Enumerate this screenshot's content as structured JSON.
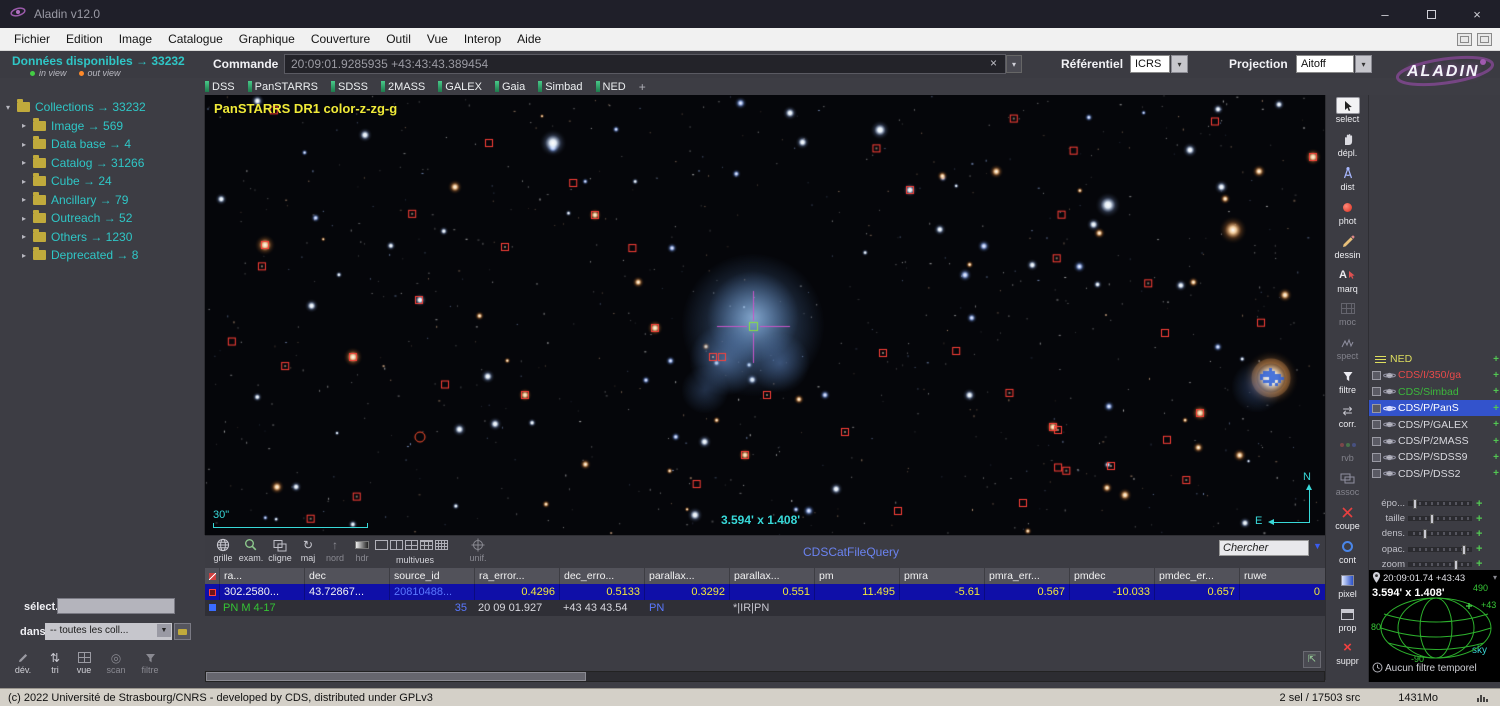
{
  "window": {
    "title": "Aladin v12.0",
    "status_left": "(c) 2022 Université de Strasbourg/CNRS - developed by CDS, distributed under GPLv3",
    "status_sel": "2 sel / 17503 src",
    "status_mem": "1431Mo"
  },
  "icons": {
    "minimize": "–",
    "close": "×",
    "dropdown": "▾",
    "down_arrow": "▼",
    "up_arrow": "▲",
    "plus": "+",
    "clear": "×",
    "refresh": "↻",
    "swap": "⇄",
    "sort": "⇅",
    "scan": "◎",
    "north": "↑",
    "export": "⇱"
  },
  "menu": {
    "items": [
      "Fichier",
      "Edition",
      "Image",
      "Catalogue",
      "Graphique",
      "Couverture",
      "Outil",
      "Vue",
      "Interop",
      "Aide"
    ]
  },
  "topbar": {
    "available": "Données disponibles → 33232",
    "in_view": "in view",
    "out_view": "out view",
    "command_label": "Commande",
    "command_value": "20:09:01.9285935 +43:43:43.389454",
    "referential_label": "Référentiel",
    "referential_value": "ICRS",
    "projection_label": "Projection",
    "projection_value": "Aitoff",
    "logo": "ALADIN"
  },
  "server_tabs": {
    "items": [
      "DSS",
      "PanSTARRS",
      "SDSS",
      "2MASS",
      "GALEX",
      "Gaia",
      "Simbad",
      "NED"
    ],
    "add": "+"
  },
  "tree": {
    "root": "Collections → 33232",
    "items": [
      "Image → 569",
      "Data base → 4",
      "Catalog → 31266",
      "Cube → 24",
      "Ancillary → 79",
      "Outreach → 52",
      "Others → 1230",
      "Deprecated → 8"
    ]
  },
  "sky": {
    "survey_label": "PanSTARRS DR1 color-z-zg-g",
    "scale": "30\"",
    "fov": "3.594' x 1.408'",
    "north": "N",
    "east": "E"
  },
  "view_toolbar": {
    "labels": [
      "grille",
      "exam.",
      "cligne",
      "maj",
      "nord",
      "hdr",
      "multivues",
      "unif."
    ],
    "center": "CDSCatFileQuery",
    "search": "Chercher"
  },
  "right_toolbar": {
    "items": [
      "select",
      "dépl.",
      "dist",
      "phot",
      "dessin",
      "marq",
      "moc",
      "spect",
      "filtre",
      "corr.",
      "rvb",
      "assoc",
      "coupe",
      "cont",
      "pixel",
      "prop",
      "suppr"
    ]
  },
  "stack": {
    "planes": [
      {
        "label": "NED",
        "color": "#dede5e",
        "selected": false
      },
      {
        "label": "CDS/I/350/ga",
        "color": "#e84a4a",
        "selected": false
      },
      {
        "label": "CDS/Simbad",
        "color": "#3cb83c",
        "selected": false
      },
      {
        "label": "CDS/P/PanS",
        "color": "#ffffff",
        "selected": true
      },
      {
        "label": "CDS/P/GALEX",
        "color": "#d8d8de",
        "selected": false
      },
      {
        "label": "CDS/P/2MASS",
        "color": "#d8d8de",
        "selected": false
      },
      {
        "label": "CDS/P/SDSS9",
        "color": "#d8d8de",
        "selected": false
      },
      {
        "label": "CDS/P/DSS2",
        "color": "#d8d8de",
        "selected": false
      }
    ],
    "sliders": [
      "épo...",
      "taille",
      "dens.",
      "opac.",
      "zoom"
    ]
  },
  "locator": {
    "position": "20:09:01.74 +43:43",
    "fov": "3.594' x 1.408'",
    "g1": "490",
    "g2": "+43",
    "g3": "80",
    "g4": "-90",
    "sky": "sky",
    "temporal": "Aucun filtre temporel"
  },
  "table": {
    "headers": [
      "ra...",
      "dec",
      "source_id",
      "ra_error...",
      "dec_erro...",
      "parallax...",
      "parallax...",
      "pm",
      "pmra",
      "pmra_err...",
      "pmdec",
      "pmdec_er...",
      "ruwe"
    ],
    "row1": [
      "302.2580...",
      "43.72867...",
      "20810488...",
      "0.4296",
      "0.5133",
      "0.3292",
      "0.551",
      "11.495",
      "-5.61",
      "0.567",
      "-10.033",
      "0.657",
      "0"
    ],
    "row2": {
      "name": "PN M  4-17",
      "id": "35",
      "ra": "20 09 01.927",
      "dec": "+43 43 43.54",
      "type": "PN",
      "flags": "*|IR|PN"
    }
  },
  "left_controls": {
    "select_label": "sélect.",
    "in_label": "dans",
    "collections": "-- toutes les coll..."
  },
  "bottom_tools": {
    "items": [
      "dév.",
      "tri",
      "vue",
      "scan",
      "filtre"
    ]
  }
}
